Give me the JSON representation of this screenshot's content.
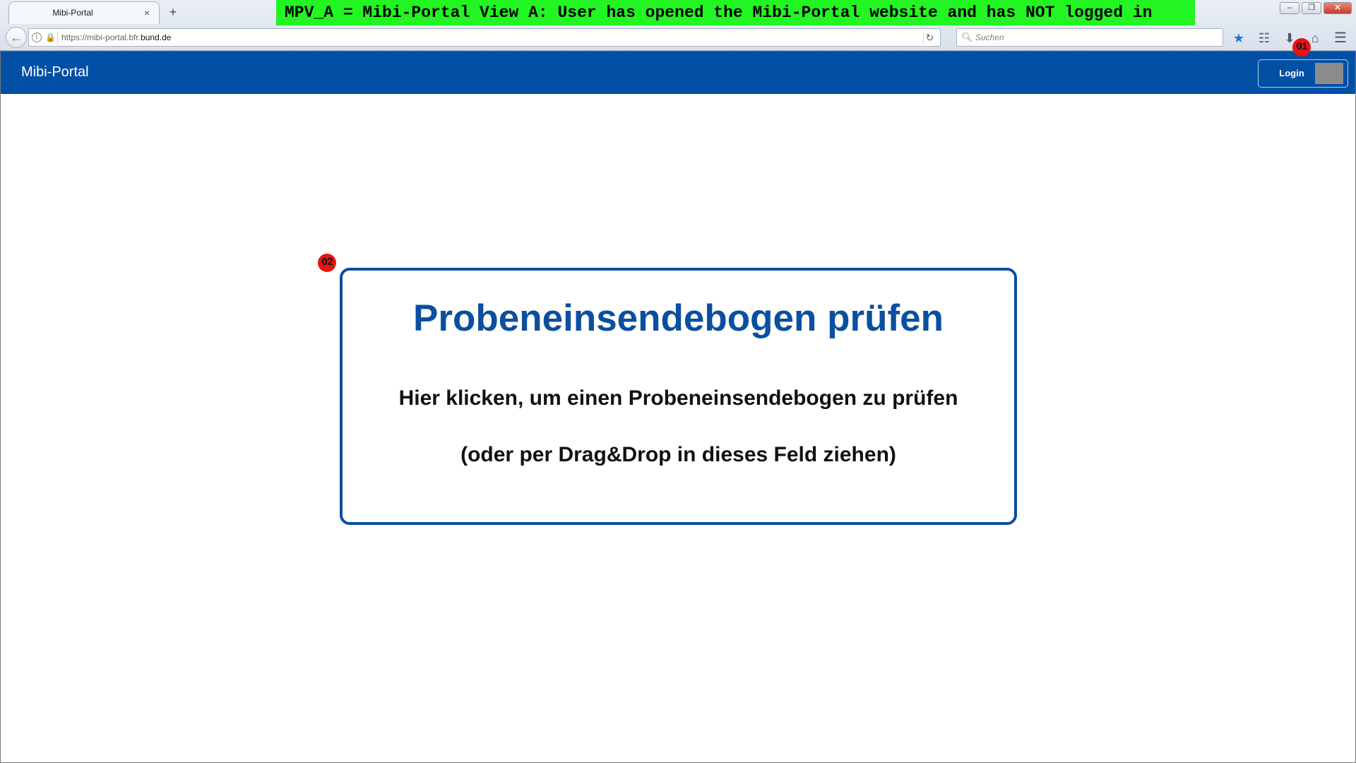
{
  "browser": {
    "tab": {
      "title": "Mibi-Portal",
      "close": "×"
    },
    "new_tab": "+",
    "url": {
      "prefix": "https://mibi-portal.bfr.",
      "domain": "bund.de"
    },
    "search_placeholder": "Suchen",
    "window_controls": {
      "minimize": "–",
      "maximize": "❐",
      "close": "✕"
    }
  },
  "annotation": {
    "banner": "MPV_A = Mibi-Portal View A: User has opened the Mibi-Portal website and has NOT logged in",
    "marker_01": "01",
    "marker_02": "02",
    "banner_color": "#22f522",
    "marker_color": "#ee1111"
  },
  "header": {
    "brand": "Mibi-Portal",
    "login_label": "Login",
    "background_color": "#0150a6"
  },
  "dropzone": {
    "title": "Probeneinsendebogen prüfen",
    "line1": "Hier klicken, um einen Probeneinsendebogen zu prüfen",
    "line2": "(oder per Drag&Drop in dieses Feld ziehen)",
    "accent_color": "#0a4fa0"
  },
  "icons": {
    "back": "back-arrow-icon",
    "info": "info-icon",
    "lock": "lock-icon",
    "reload": "reload-icon",
    "search": "search-icon",
    "bookmark": "star-icon",
    "library": "clipboard-icon",
    "download": "download-arrow-icon",
    "home": "home-icon",
    "menu": "hamburger-menu-icon"
  }
}
